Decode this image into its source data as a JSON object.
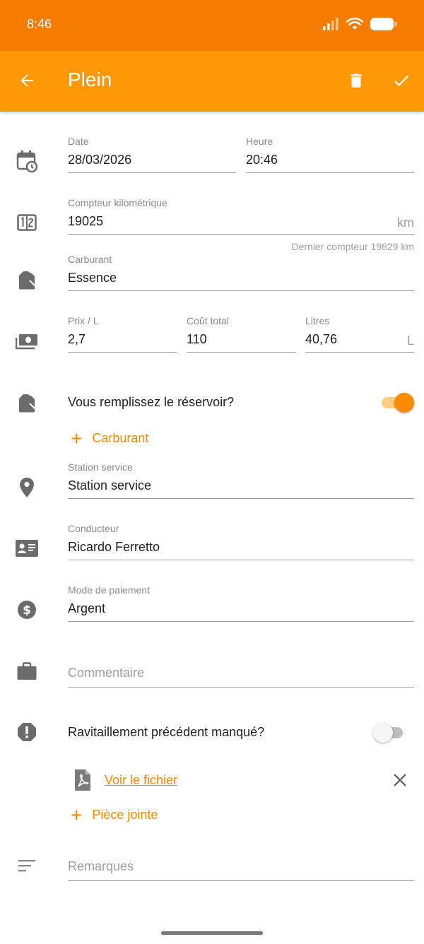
{
  "status_bar": {
    "time": "8:46"
  },
  "app_bar": {
    "title": "Plein"
  },
  "colors": {
    "accent": "#ff9800",
    "status": "#f57c00",
    "link": "#ef8a00"
  },
  "form": {
    "date": {
      "label": "Date",
      "value": "28/03/2026"
    },
    "time": {
      "label": "Heure",
      "value": "20:46"
    },
    "odometer": {
      "label": "Compteur kilométrique",
      "value": "19025",
      "unit": "km",
      "hint": "Dernier compteur 19829 km"
    },
    "fuel": {
      "label": "Carburant",
      "value": "Essence"
    },
    "price": {
      "label": "Prix / L",
      "value": "2,7"
    },
    "total": {
      "label": "Coût total",
      "value": "110"
    },
    "liters": {
      "label": "Litres",
      "value": "40,76",
      "unit": "L"
    },
    "full_tank": {
      "label": "Vous remplissez le réservoir?",
      "enabled": true
    },
    "add_fuel": {
      "label": "Carburant"
    },
    "station": {
      "label": "Station service",
      "value": "Station service"
    },
    "driver": {
      "label": "Conducteur",
      "value": "Ricardo Ferretto"
    },
    "payment": {
      "label": "Mode de paiement",
      "value": "Argent"
    },
    "comment": {
      "placeholder": "Commentaire"
    },
    "missed": {
      "label": "Ravitaillement précédent manqué?",
      "enabled": false
    },
    "file": {
      "label": "Voir le fichier"
    },
    "attachment": {
      "label": "Pièce jointe"
    },
    "notes": {
      "placeholder": "Remarques"
    }
  }
}
